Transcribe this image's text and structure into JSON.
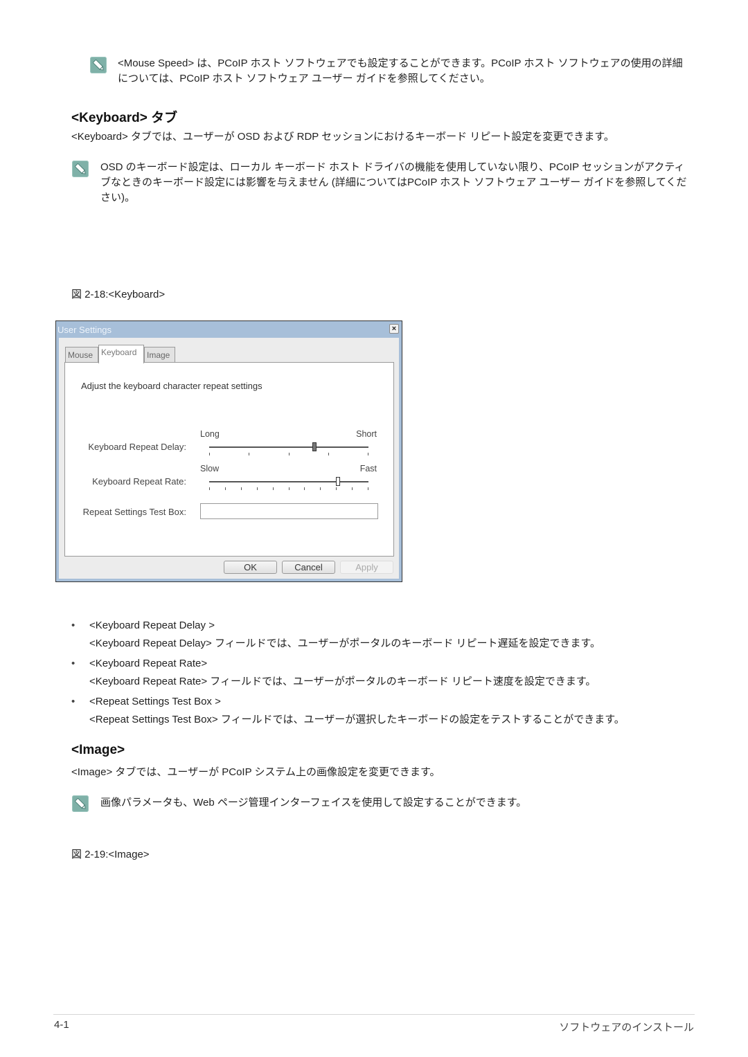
{
  "notes": {
    "mouse_speed": "<Mouse Speed> は、PCoIP ホスト ソフトウェアでも設定することができます。PCoIP ホスト ソフトウェアの使用の詳細については、PCoIP ホスト ソフトウェア ユーザー ガイドを参照してください。",
    "osd_keyboard": "OSD のキーボード設定は、ローカル キーボード ホスト ドライバの機能を使用していない限り、PCoIP セッションがアクティブなときのキーボード設定には影響を与えません (詳細についてはPCoIP ホスト ソフトウェア ユーザー ガイドを参照してください)。",
    "image_params": "画像パラメータも、Web ページ管理インターフェイスを使用して設定することができます。",
    "icon": "pencil-note-icon"
  },
  "keyboard_section": {
    "heading": "<Keyboard> タブ",
    "intro": "<Keyboard> タブでは、ユーザーが OSD および RDP セッションにおけるキーボード リピート設定を変更できます。",
    "figure_caption": "図 2-18:<Keyboard>"
  },
  "dialog": {
    "title": "User Settings",
    "close_glyph": "×",
    "tabs": [
      {
        "label": "Mouse",
        "active": false
      },
      {
        "label": "Keyboard",
        "active": true
      },
      {
        "label": "Image",
        "active": false
      }
    ],
    "description": "Adjust the keyboard character repeat settings",
    "repeat_delay": {
      "label": "Keyboard Repeat Delay:",
      "min_label": "Long",
      "max_label": "Short",
      "ticks": 5,
      "value_fraction": 0.66
    },
    "repeat_rate": {
      "label": "Keyboard Repeat Rate:",
      "min_label": "Slow",
      "max_label": "Fast",
      "ticks": 11,
      "value_fraction": 0.81
    },
    "test_box": {
      "label": "Repeat Settings Test Box:",
      "value": ""
    },
    "buttons": {
      "ok": "OK",
      "cancel": "Cancel",
      "apply": "Apply"
    }
  },
  "bullets": [
    {
      "title": "<Keyboard Repeat Delay >",
      "desc": "<Keyboard Repeat Delay> フィールドでは、ユーザーがポータルのキーボード リピート遅延を設定できます。"
    },
    {
      "title": "<Keyboard Repeat Rate>",
      "desc": "<Keyboard Repeat Rate> フィールドでは、ユーザーがポータルのキーボード リピート速度を設定できます。"
    },
    {
      "title": "<Repeat Settings Test Box >",
      "desc": "<Repeat Settings Test Box> フィールドでは、ユーザーが選択したキーボードの設定をテストすることができます。"
    }
  ],
  "bullet_glyph": "•",
  "image_section": {
    "heading": "<Image>",
    "intro": "<Image> タブでは、ユーザーが PCoIP システム上の画像設定を変更できます。",
    "figure_caption": "図 2-19:<Image>"
  },
  "footer": {
    "page_number": "4-1",
    "chapter": "ソフトウェアのインストール"
  }
}
